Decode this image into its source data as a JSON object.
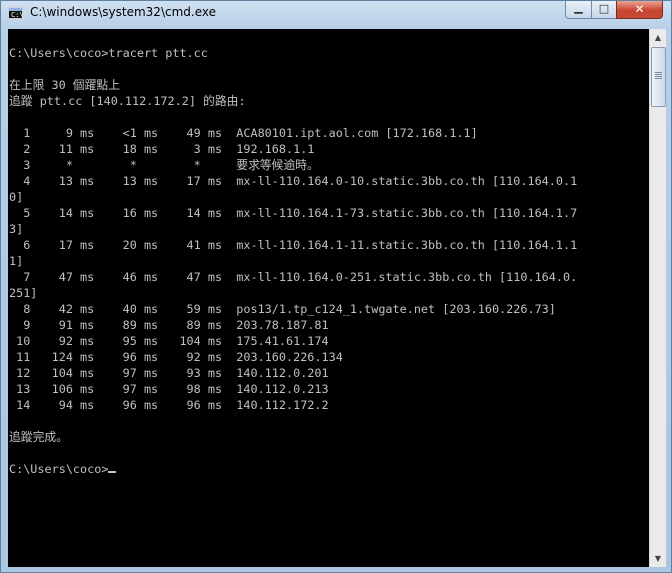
{
  "window": {
    "title": "C:\\windows\\system32\\cmd.exe",
    "app_icon_text": "C:\\",
    "buttons": {
      "minimize_icon": "minimize-icon",
      "maximize_icon": "maximize-icon",
      "close_icon": "close-icon"
    }
  },
  "console": {
    "lines": [
      "C:\\Users\\coco>tracert ptt.cc",
      "",
      "在上限 30 個躍點上",
      "追蹤 ptt.cc [140.112.172.2] 的路由:",
      "",
      "  1     9 ms    <1 ms    49 ms  ACA80101.ipt.aol.com [172.168.1.1]",
      "  2    11 ms    18 ms     3 ms  192.168.1.1",
      "  3     *        *        *     要求等候逾時。",
      "  4    13 ms    13 ms    17 ms  mx-ll-110.164.0-10.static.3bb.co.th [110.164.0.1",
      "0]",
      "  5    14 ms    16 ms    14 ms  mx-ll-110.164.1-73.static.3bb.co.th [110.164.1.7",
      "3]",
      "  6    17 ms    20 ms    41 ms  mx-ll-110.164.1-11.static.3bb.co.th [110.164.1.1",
      "1]",
      "  7    47 ms    46 ms    47 ms  mx-ll-110.164.0-251.static.3bb.co.th [110.164.0.",
      "251]",
      "  8    42 ms    40 ms    59 ms  pos13/1.tp_c124_1.twgate.net [203.160.226.73]",
      "  9    91 ms    89 ms    89 ms  203.78.187.81",
      " 10    92 ms    95 ms   104 ms  175.41.61.174",
      " 11   124 ms    96 ms    92 ms  203.160.226.134",
      " 12   104 ms    97 ms    93 ms  140.112.0.201",
      " 13   106 ms    97 ms    98 ms  140.112.0.213",
      " 14    94 ms    96 ms    96 ms  140.112.172.2",
      "",
      "追蹤完成。",
      "",
      "C:\\Users\\coco>"
    ]
  },
  "scrollbar": {
    "up_icon": "scroll-up-arrow-icon",
    "down_icon": "scroll-down-arrow-icon"
  },
  "colors": {
    "console_bg": "#000000",
    "console_fg": "#c0c0c0",
    "close_button": "#c9452f"
  }
}
